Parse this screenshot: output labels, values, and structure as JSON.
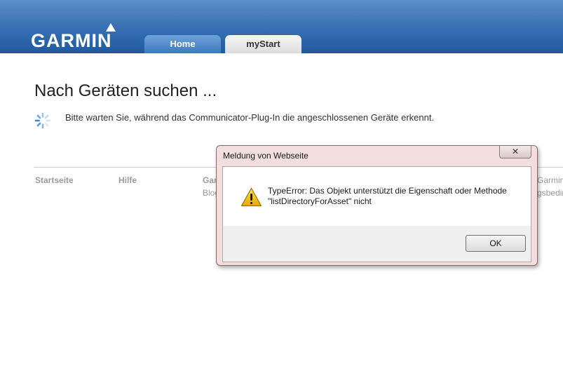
{
  "header": {
    "logo_text": "GARMIN",
    "tabs": [
      {
        "label": "Home"
      },
      {
        "label": "myStart"
      }
    ]
  },
  "main": {
    "title": "Nach Geräten suchen ...",
    "wait_message": "Bitte warten Sie, während das Communicator-Plug-In die angeschlossenen Geräte erkennt."
  },
  "footer": {
    "links": [
      "Startseite",
      "Hilfe",
      "Gar",
      "Garmin"
    ],
    "sublinks": [
      "Blog",
      "gsbedin"
    ]
  },
  "dialog": {
    "title": "Meldung von Webseite",
    "close_glyph": "✕",
    "message_line1": "TypeError: Das Objekt unterstützt die Eigenschaft oder Methode",
    "message_line2": "\"listDirectoryForAsset\" nicht",
    "ok_label": "OK"
  },
  "colors": {
    "header_blue": "#3c74b5",
    "dialog_frame": "#f3dede",
    "warning_yellow": "#f2c200"
  }
}
